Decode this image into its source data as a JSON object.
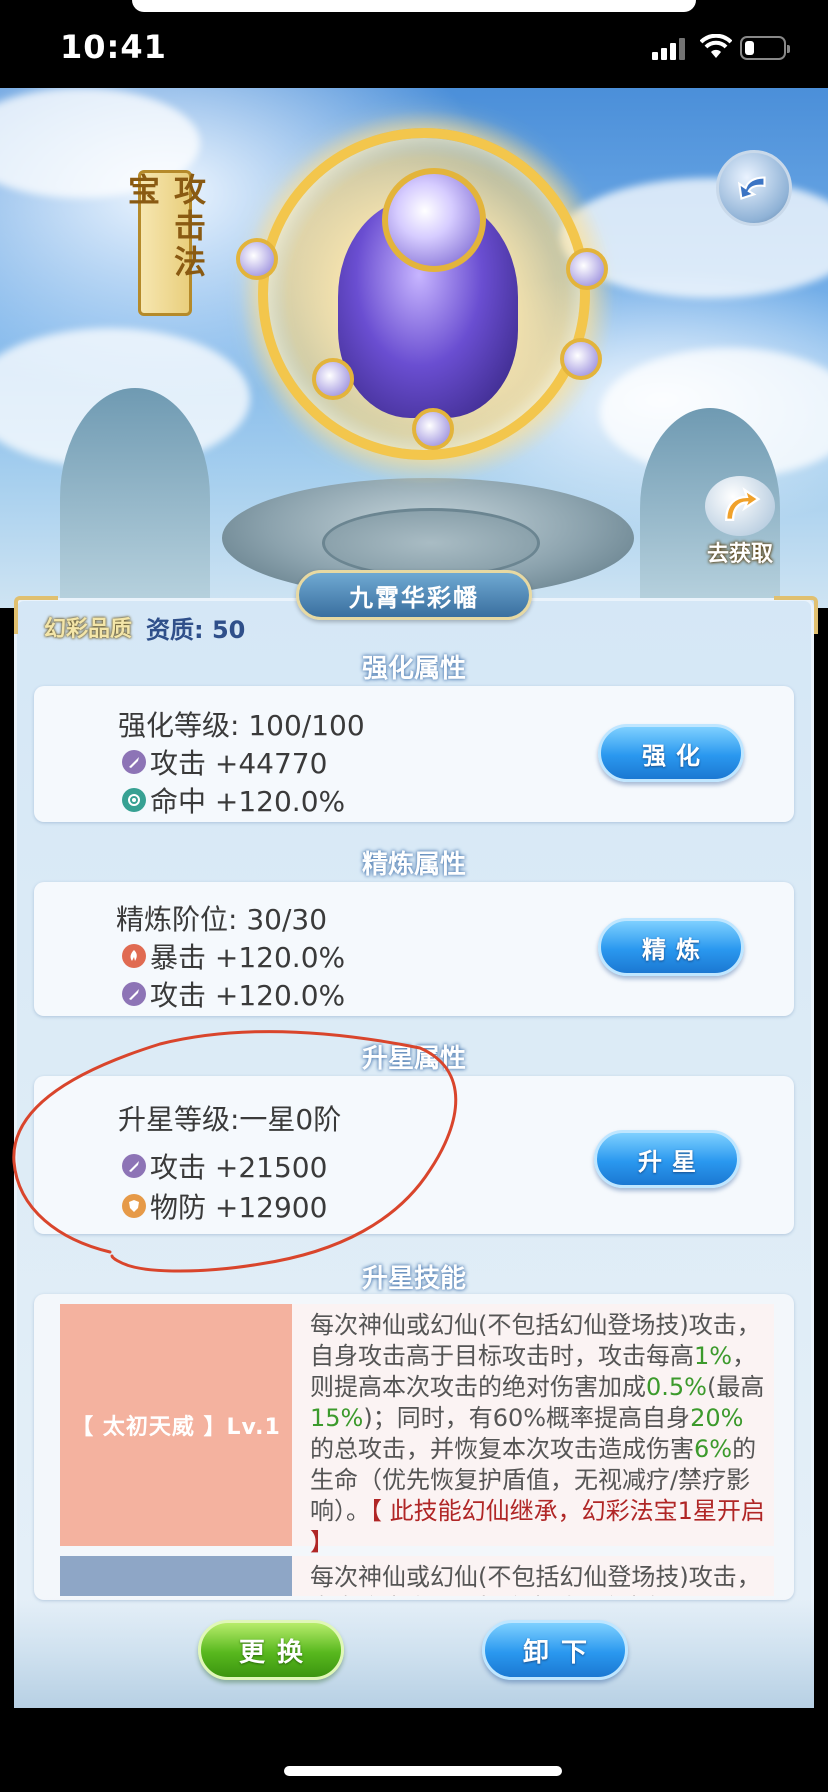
{
  "status_bar": {
    "time": "10:41",
    "battery_level": 0.25
  },
  "scene": {
    "category_badge": "攻击法宝",
    "source_button_label": "去获取"
  },
  "treasure": {
    "name": "九霄华彩幡",
    "quality": "幻彩品质",
    "aptitude": "资质: 50"
  },
  "sections": {
    "enhance": {
      "title": "强化属性",
      "level": "强化等级: 100/100",
      "stats": [
        "攻击 +44770",
        "命中 +120.0%"
      ],
      "button": "强化"
    },
    "refine": {
      "title": "精炼属性",
      "level": "精炼阶位: 30/30",
      "stats": [
        "暴击 +120.0%",
        "攻击 +120.0%"
      ],
      "button": "精炼"
    },
    "star": {
      "title": "升星属性",
      "level": "升星等级:一星0阶",
      "stats": [
        "攻击 +21500",
        "物防 +12900"
      ],
      "button": "升星"
    },
    "skills": {
      "title": "升星技能",
      "items": [
        {
          "name": "【 太初天威 】Lv.1",
          "desc": {
            "p1": "每次神仙或幻仙(不包括幻仙登场技)攻击，自身攻击高于目标攻击时，攻击每高",
            "v1": "1%",
            "p2": "，则提高本次攻击的绝对伤害加成",
            "v2": "0.5%",
            "p3": "(最高",
            "v3": "15%",
            "p4": ")；同时，有60%概率提高自身",
            "v4": "20%",
            "p5": "的总攻击，并恢复本次攻击造成伤害",
            "v5": "6%",
            "p6": "的生命（优先恢复护盾值，无视减疗/禁疗影响）。",
            "note": "【 此技能幻仙继承，幻彩法宝1星开启 】"
          }
        },
        {
          "name": "",
          "desc_partial": "每次神仙或幻仙(不包括幻仙登场技)攻击，自身攻击高于目标攻击时，攻击每"
        }
      ]
    }
  },
  "bottom_buttons": {
    "replace": "更换",
    "unequip": "卸下"
  },
  "colors": {
    "skill_name_bg": "#f4b29f",
    "skill_name_bg_2": "#8ea6c6",
    "highlight_green": "#3c9a2c",
    "highlight_red": "#b02626",
    "annotation": "#d9452c"
  }
}
